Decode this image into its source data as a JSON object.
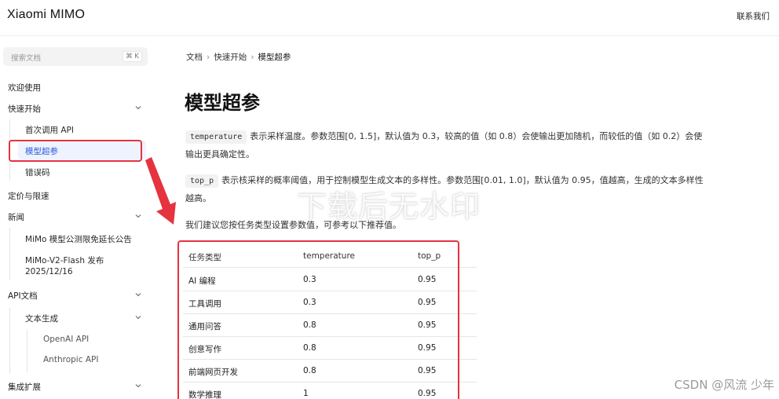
{
  "header": {
    "logo": "Xiaomi MIMO",
    "contact": "联系我们"
  },
  "search": {
    "placeholder": "搜索文档",
    "shortcut": "⌘ K"
  },
  "sidebar": {
    "items": [
      {
        "label": "欢迎使用"
      },
      {
        "label": "快速开始",
        "expanded": true
      },
      {
        "label": "首次调用 API"
      },
      {
        "label": "模型超参",
        "active": true
      },
      {
        "label": "错误码"
      },
      {
        "label": "定价与限速"
      },
      {
        "label": "新闻",
        "expanded": true
      },
      {
        "label": "MiMo 模型公测限免延长公告"
      },
      {
        "label": "MiMo-V2-Flash 发布"
      },
      {
        "label": "2025/12/16"
      },
      {
        "label": "API文档",
        "expanded": true
      },
      {
        "label": "文本生成",
        "expanded": true
      },
      {
        "label": "OpenAI API"
      },
      {
        "label": "Anthropic API"
      },
      {
        "label": "集成扩展",
        "expanded": true
      }
    ]
  },
  "breadcrumb": {
    "items": [
      "文档",
      "快速开始",
      "模型超参"
    ]
  },
  "page": {
    "title": "模型超参",
    "p1_code": "temperature",
    "p1_line1": "表示采样温度。参数范围[0, 1.5]，默认值为 0.3，较高的值（如 0.8）会使输出更加随机，而较低的值（如 0.2）会使",
    "p1_line2": "输出更具确定性。",
    "p2_code": "top_p",
    "p2_line1": "表示核采样的概率阈值，用于控制模型生成文本的多样性。参数范围[0.01, 1.0]，默认值为 0.95，值越高，生成的文本多样性",
    "p2_line2": "越高。",
    "p3": "我们建议您按任务类型设置参数值，可参考以下推荐值。"
  },
  "table": {
    "headers": [
      "任务类型",
      "temperature",
      "top_p"
    ],
    "rows": [
      [
        "AI 编程",
        "0.3",
        "0.95"
      ],
      [
        "工具调用",
        "0.3",
        "0.95"
      ],
      [
        "通用问答",
        "0.8",
        "0.95"
      ],
      [
        "创意写作",
        "0.8",
        "0.95"
      ],
      [
        "前端网页开发",
        "0.8",
        "0.95"
      ],
      [
        "数学推理",
        "1",
        "0.95"
      ]
    ]
  },
  "overlay": {
    "watermark": "下载后无水印",
    "credit_prefix": "CSDN",
    "credit_name": "@风流 少年"
  },
  "colors": {
    "highlight": "#e5333f",
    "active_text": "#2a5bd7"
  }
}
